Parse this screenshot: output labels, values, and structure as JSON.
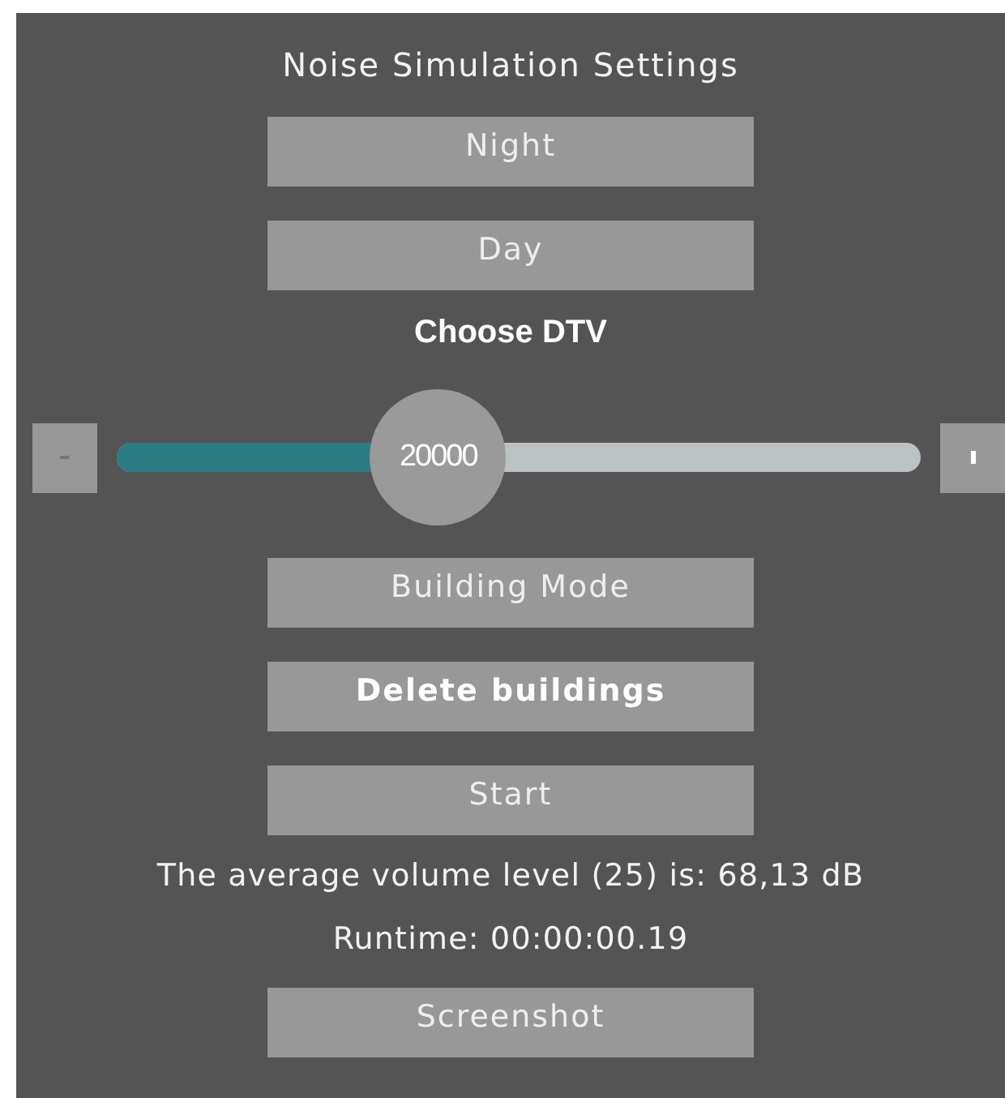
{
  "title": "Noise Simulation Settings",
  "top_buttons": [
    {
      "label": "Night",
      "bold": false
    },
    {
      "label": "Day",
      "bold": false
    }
  ],
  "slider": {
    "label": "Choose DTV",
    "value": "20000",
    "level": 0.4
  },
  "bottom_buttons": [
    {
      "label": "Building Mode",
      "bold": false
    },
    {
      "label": "Delete buildings",
      "bold": true
    },
    {
      "label": "Start",
      "bold": false
    }
  ],
  "average_text": "The average volume level (25) is: 68,13 dB",
  "runtime_text": "Runtime: 00:00:00.19",
  "screenshot_button": {
    "label": "Screenshot",
    "bold": false
  }
}
